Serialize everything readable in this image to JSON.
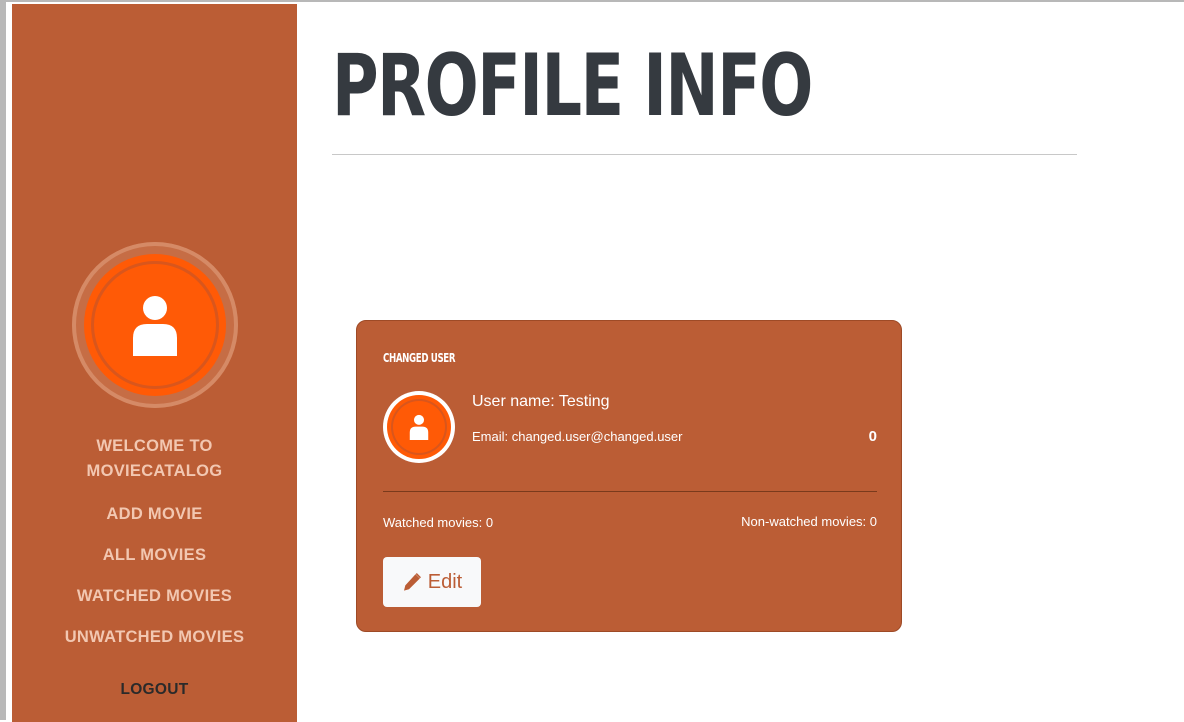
{
  "sidebar": {
    "welcome_line1": "WELCOME TO",
    "welcome_line2": "MOVIECATALOG",
    "items": [
      {
        "label": "ADD MOVIE"
      },
      {
        "label": "ALL MOVIES"
      },
      {
        "label": "WATCHED MOVIES"
      },
      {
        "label": "UNWATCHED MOVIES"
      }
    ],
    "logout_label": "LOGOUT",
    "avatar_icon": "user-icon"
  },
  "main": {
    "title": "PROFILE INFO"
  },
  "profile_card": {
    "header": "CHANGED USER",
    "avatar_icon": "user-icon",
    "username": "User name: Testing",
    "email": "Email: changed.user@changed.user",
    "count": "0",
    "watched": "Watched movies: 0",
    "non_watched": "Non-watched movies: 0",
    "edit_label": "Edit",
    "edit_icon": "pencil-icon"
  },
  "colors": {
    "sidebar_bg": "#bb5d35",
    "accent_orange": "#ff5a06",
    "nav_text": "#f2c7b1",
    "title_text": "#353a40"
  }
}
